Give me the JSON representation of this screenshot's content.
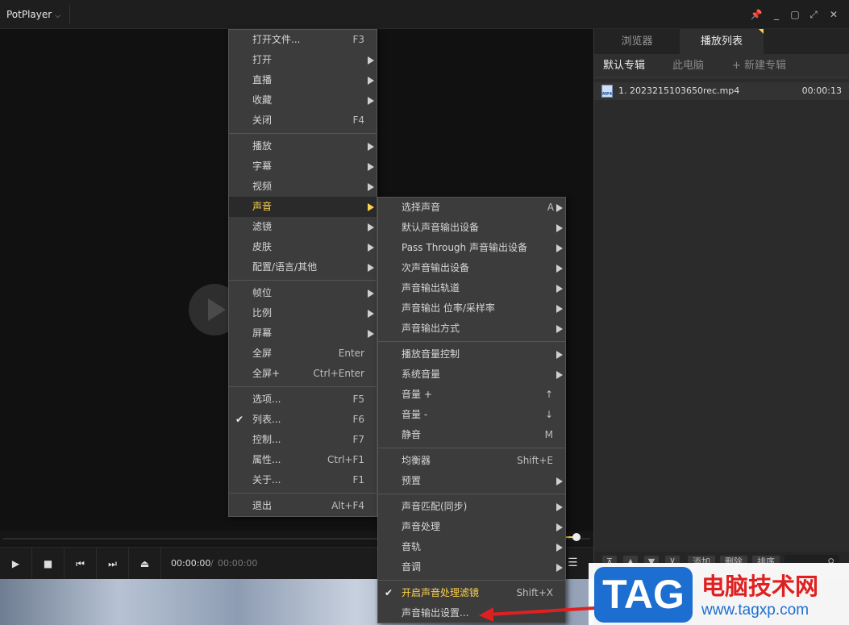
{
  "titlebar": {
    "app_name": "PotPlayer",
    "chevron": "⌵",
    "buttons": [
      "📌",
      "_",
      "▢",
      "⤢",
      "✕"
    ]
  },
  "controls": {
    "time_current": "00:00:00",
    "time_separator": "/",
    "time_total": "00:00:00",
    "menu_icon": "☰",
    "play": "▶",
    "stop": "■",
    "prev": "⏮",
    "next": "⏭",
    "eject": "⏏"
  },
  "panel": {
    "tabs": [
      "浏览器",
      "播放列表"
    ],
    "subtabs": [
      "默认专辑",
      "此电脑",
      "+ 新建专辑"
    ],
    "playlist": [
      {
        "name": "1. 2023215103650rec.mp4",
        "duration": "00:00:13",
        "icon_text": "MP4"
      }
    ],
    "bottom_buttons": [
      "⊼",
      "▲",
      "▼",
      "⊻",
      "添加",
      "删除",
      "排序"
    ],
    "search_icon": "⚲"
  },
  "menu_main": [
    {
      "label": "打开文件...",
      "shortcut": "F3"
    },
    {
      "label": "打开",
      "submenu": true
    },
    {
      "label": "直播",
      "submenu": true
    },
    {
      "label": "收藏",
      "submenu": true
    },
    {
      "label": "关闭",
      "shortcut": "F4"
    },
    {
      "label": "播放",
      "submenu": true
    },
    {
      "label": "字幕",
      "submenu": true
    },
    {
      "label": "视频",
      "submenu": true
    },
    {
      "label": "声音",
      "submenu": true,
      "highlighted": true
    },
    {
      "label": "滤镜",
      "submenu": true
    },
    {
      "label": "皮肤",
      "submenu": true
    },
    {
      "label": "配置/语言/其他",
      "submenu": true
    },
    {
      "label": "帧位",
      "submenu": true
    },
    {
      "label": "比例",
      "submenu": true
    },
    {
      "label": "屏幕",
      "submenu": true
    },
    {
      "label": "全屏",
      "shortcut": "Enter"
    },
    {
      "label": "全屏+",
      "shortcut": "Ctrl+Enter"
    },
    {
      "label": "选项...",
      "shortcut": "F5"
    },
    {
      "label": "列表...",
      "shortcut": "F6",
      "checked": true
    },
    {
      "label": "控制...",
      "shortcut": "F7"
    },
    {
      "label": "属性...",
      "shortcut": "Ctrl+F1"
    },
    {
      "label": "关于...",
      "shortcut": "F1"
    },
    {
      "label": "退出",
      "shortcut": "Alt+F4"
    }
  ],
  "menu_sound": [
    {
      "label": "选择声音",
      "shortcut": "A",
      "submenu": true
    },
    {
      "label": "默认声音输出设备",
      "submenu": true
    },
    {
      "label": "Pass Through 声音输出设备",
      "submenu": true
    },
    {
      "label": "次声音输出设备",
      "submenu": true
    },
    {
      "label": "声音输出轨道",
      "submenu": true
    },
    {
      "label": "声音输出 位率/采样率",
      "submenu": true
    },
    {
      "label": "声音输出方式",
      "submenu": true
    },
    {
      "label": "播放音量控制",
      "submenu": true
    },
    {
      "label": "系统音量",
      "submenu": true
    },
    {
      "label": "音量 +",
      "shortcut": "↑"
    },
    {
      "label": "音量 -",
      "shortcut": "↓"
    },
    {
      "label": "静音",
      "shortcut": "M"
    },
    {
      "label": "均衡器",
      "shortcut": "Shift+E"
    },
    {
      "label": "预置",
      "submenu": true
    },
    {
      "label": "声音匹配(同步)",
      "submenu": true
    },
    {
      "label": "声音处理",
      "submenu": true
    },
    {
      "label": "音轨",
      "submenu": true
    },
    {
      "label": "音调",
      "submenu": true
    },
    {
      "label": "开启声音处理滤镜",
      "shortcut": "Shift+X",
      "checked": true,
      "yellow": true
    },
    {
      "label": "声音输出设置..."
    }
  ],
  "watermark": {
    "tag": "TAG",
    "title": "电脑技术网",
    "url": "www.tagxp.com"
  },
  "checkmark": "✔"
}
